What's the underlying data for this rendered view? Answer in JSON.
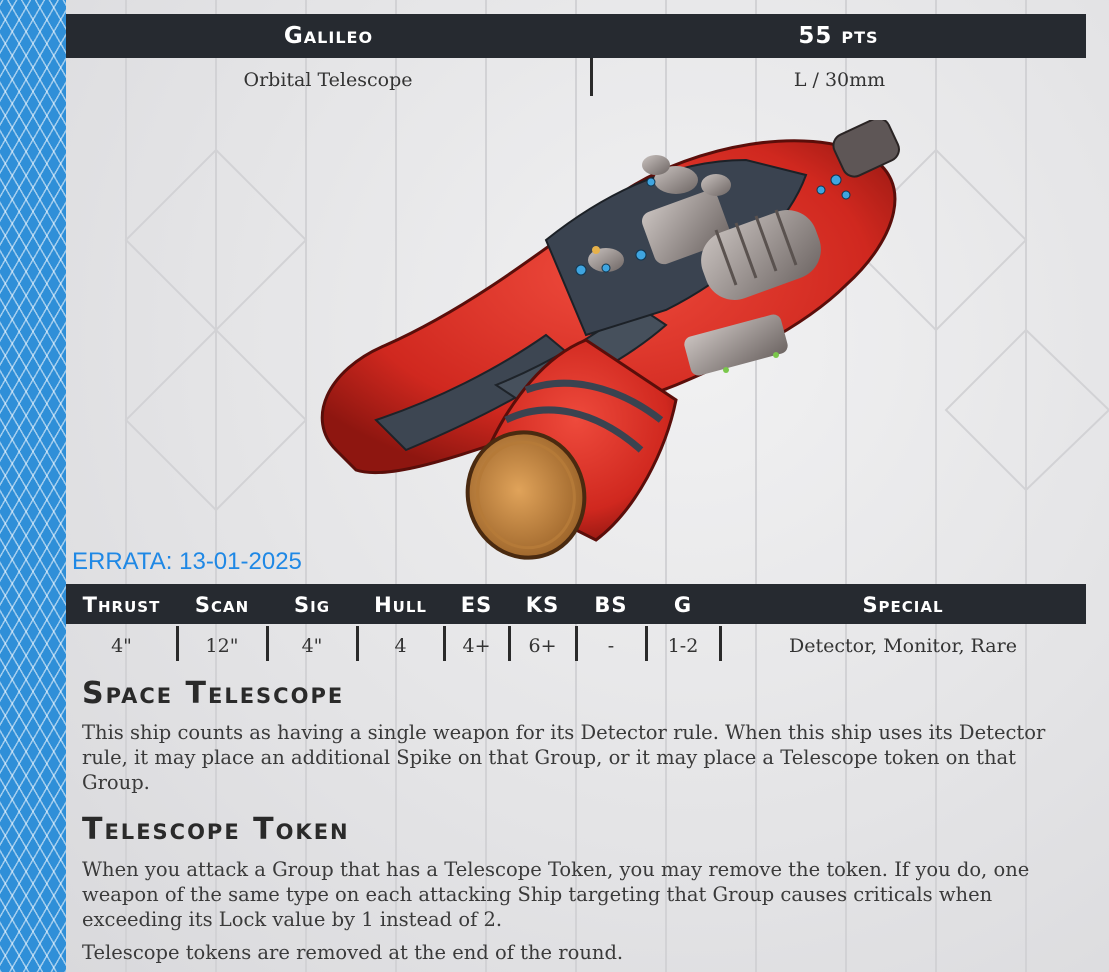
{
  "header": {
    "ship_name": "Galileo",
    "points": "55 pts",
    "ship_class": "Orbital Telescope",
    "size": "L / 30mm"
  },
  "errata": "ERRATA: 13-01-2025",
  "stats": {
    "headers": [
      "Thrust",
      "Scan",
      "Sig",
      "Hull",
      "ES",
      "KS",
      "BS",
      "G",
      "Special"
    ],
    "values": [
      "4\"",
      "12\"",
      "4\"",
      "4",
      "4+",
      "6+",
      "-",
      "1-2",
      "Detector, Monitor, Rare"
    ]
  },
  "rules": [
    {
      "title": "Space Telescope",
      "paragraphs": [
        "This ship counts as having a single weapon for its Detector rule. When this ship uses its Detector rule, it may place an additional Spike on that Group, or it may place a Telescope token on that Group."
      ]
    },
    {
      "title": "Telescope Token",
      "paragraphs": [
        "When you attack a Group that has a Telescope Token, you may remove the token. If you do, one weapon of the same type on each attacking Ship targeting that Group causes criticals when exceeding its Lock value by 1 instead of 2.",
        "Telescope tokens are removed at the end of the round."
      ]
    }
  ],
  "colors": {
    "accent_strip": "#2f8fd8",
    "bar": "#262a30",
    "errata": "#1f88e5",
    "ship_red": "#d9302a"
  },
  "image": {
    "name": "ship-miniature-image"
  }
}
